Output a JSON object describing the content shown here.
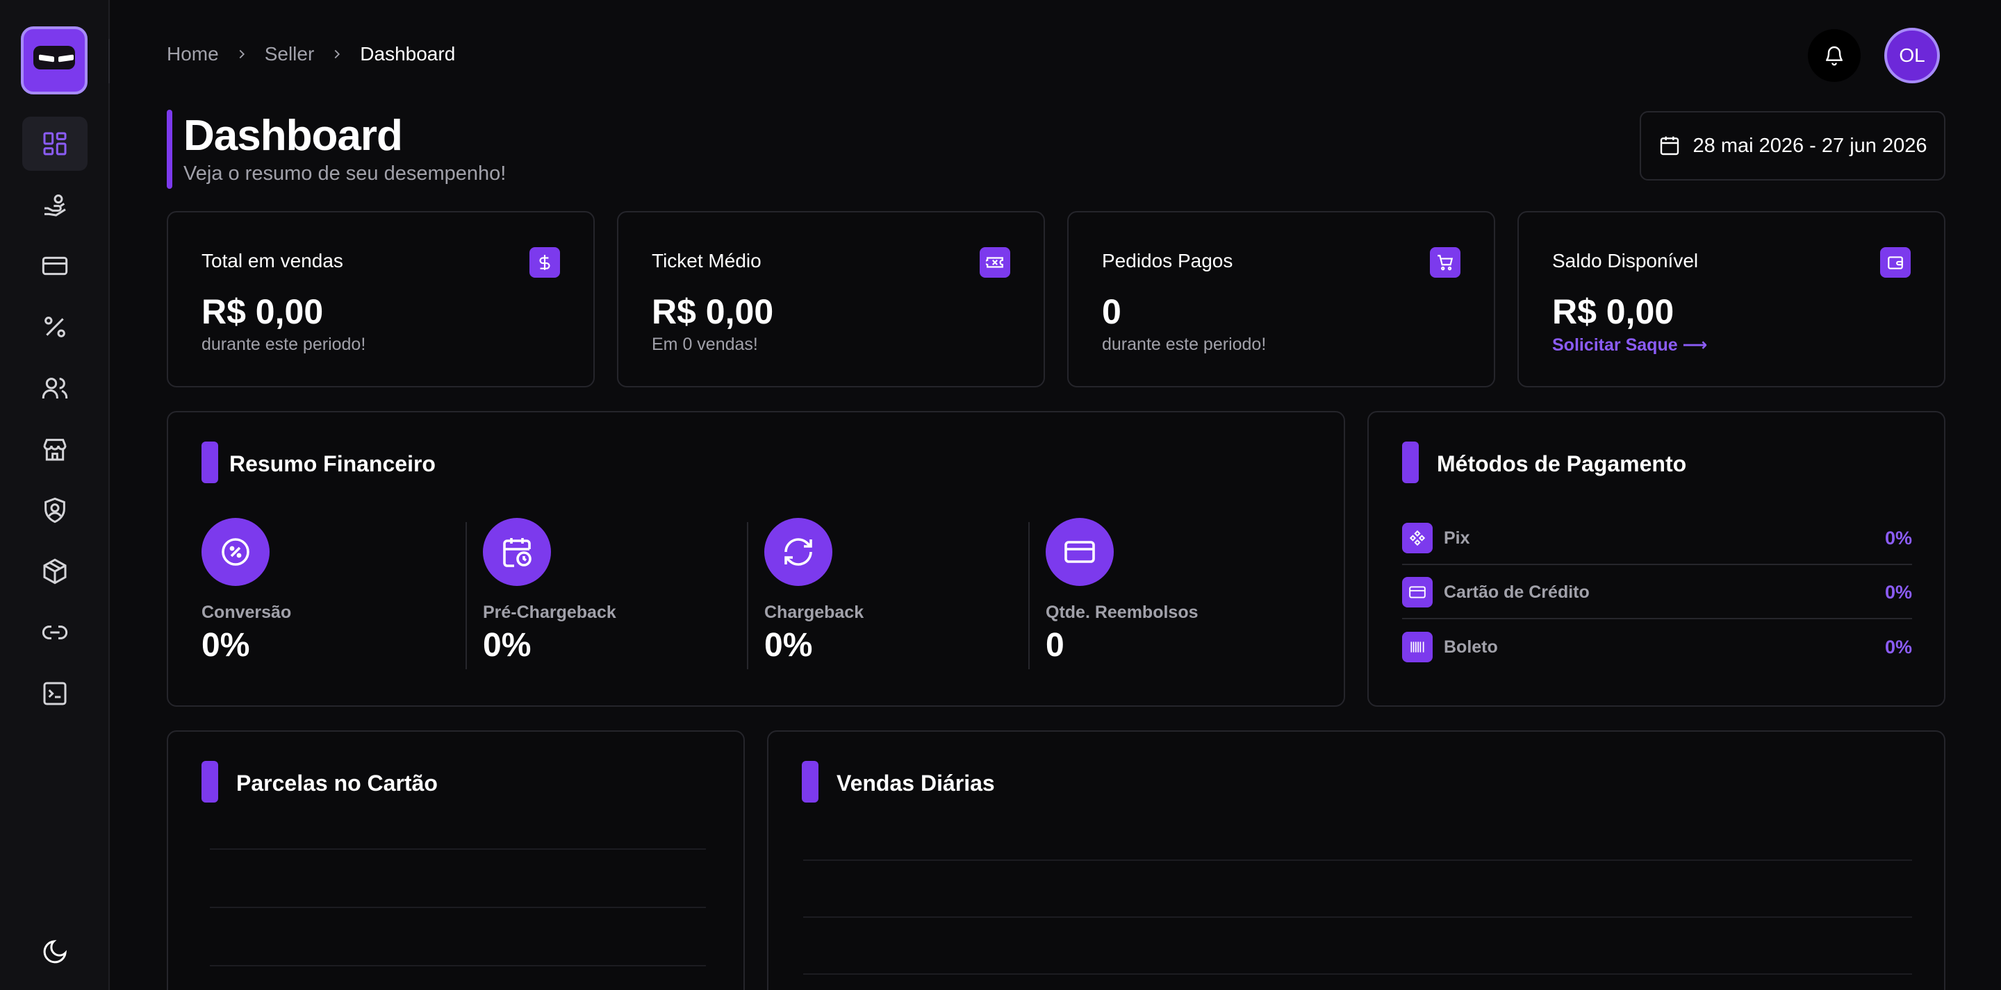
{
  "breadcrumb": {
    "home": "Home",
    "seller": "Seller",
    "current": "Dashboard"
  },
  "user": {
    "initials": "OL"
  },
  "header": {
    "title": "Dashboard",
    "subtitle": "Veja o resumo de seu desempenho!",
    "date_range": "28 mai 2026 - 27 jun 2026"
  },
  "sidebar": {
    "items": [
      {
        "icon": "dashboard-icon",
        "active": true
      },
      {
        "icon": "hand-coins-icon"
      },
      {
        "icon": "credit-card-icon"
      },
      {
        "icon": "percent-icon"
      },
      {
        "icon": "users-icon"
      },
      {
        "icon": "store-icon"
      },
      {
        "icon": "shield-user-icon"
      },
      {
        "icon": "package-icon"
      },
      {
        "icon": "link-icon"
      },
      {
        "icon": "terminal-icon"
      }
    ],
    "theme_icon": "moon-icon"
  },
  "stats": [
    {
      "label": "Total em vendas",
      "value": "R$ 0,00",
      "note": "durante este periodo!",
      "icon": "dollar-icon"
    },
    {
      "label": "Ticket Médio",
      "value": "R$ 0,00",
      "note": "Em 0 vendas!",
      "icon": "ticket-icon"
    },
    {
      "label": "Pedidos Pagos",
      "value": "0",
      "note": "durante este periodo!",
      "icon": "cart-icon"
    },
    {
      "label": "Saldo Disponível",
      "value": "R$ 0,00",
      "link": "Solicitar Saque ⟶",
      "icon": "wallet-icon"
    }
  ],
  "financial": {
    "title": "Resumo Financeiro",
    "metrics": [
      {
        "label": "Conversão",
        "value": "0%",
        "icon": "percent-badge-icon"
      },
      {
        "label": "Pré-Chargeback",
        "value": "0%",
        "icon": "calendar-clock-icon"
      },
      {
        "label": "Chargeback",
        "value": "0%",
        "icon": "refresh-icon"
      },
      {
        "label": "Qtde. Reembolsos",
        "value": "0",
        "icon": "card-icon"
      }
    ]
  },
  "payment_methods": {
    "title": "Métodos de Pagamento",
    "items": [
      {
        "name": "Pix",
        "pct": "0%",
        "icon": "pix-icon"
      },
      {
        "name": "Cartão de Crédito",
        "pct": "0%",
        "icon": "credit-card-icon"
      },
      {
        "name": "Boleto",
        "pct": "0%",
        "icon": "barcode-icon"
      }
    ]
  },
  "installments": {
    "title": "Parcelas no Cartão"
  },
  "daily_sales": {
    "title": "Vendas Diárias"
  },
  "colors": {
    "accent": "#7c3aed",
    "accent_text": "#8b5cf6",
    "background": "#0b0b0d",
    "card": "#0a0a0c"
  }
}
